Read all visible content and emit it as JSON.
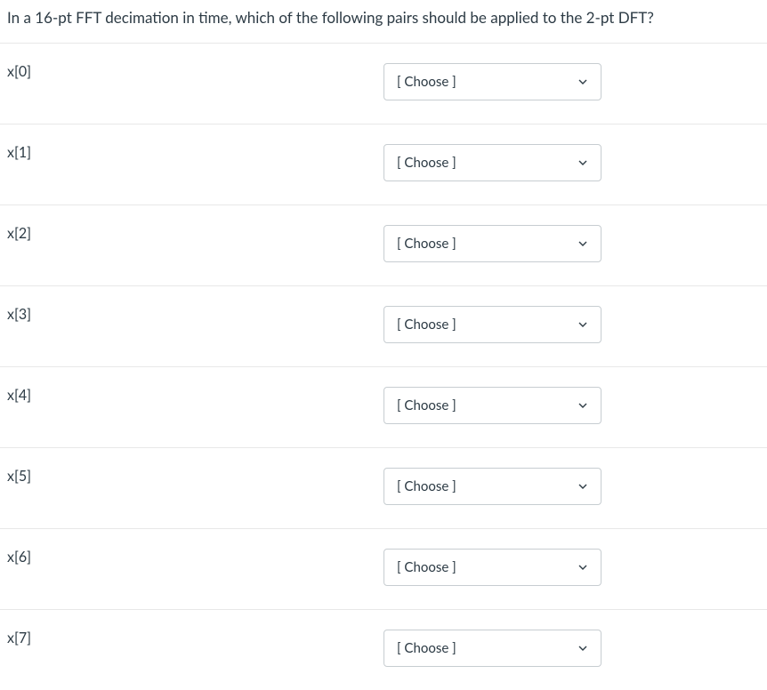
{
  "question": "In a 16-pt FFT decimation in time, which of the following pairs should be applied to the 2-pt DFT?",
  "select_placeholder": "[ Choose ]",
  "rows": [
    {
      "label": "x[0]"
    },
    {
      "label": "x[1]"
    },
    {
      "label": "x[2]"
    },
    {
      "label": "x[3]"
    },
    {
      "label": "x[4]"
    },
    {
      "label": "x[5]"
    },
    {
      "label": "x[6]"
    },
    {
      "label": "x[7]"
    }
  ]
}
